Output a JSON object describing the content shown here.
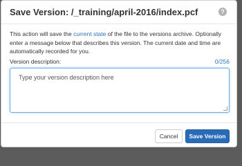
{
  "dialog": {
    "title": "Save Version: /_training/april-2016/index.pcf",
    "help_icon": "question-circle-icon",
    "description_part1": "This action will save the ",
    "description_link": "current state",
    "description_part2": " of the file to the versions archive. Optionally enter a message below that describes this version. The current date and time are automatically recorded for you.",
    "field_label": "Version description:",
    "char_count": "0/256",
    "textarea_placeholder": "Type your version description here",
    "cancel_label": "Cancel",
    "save_label": "Save Version"
  },
  "colors": {
    "link": "#2d72b8",
    "primary_button": "#2a6bb8",
    "focus_border": "#66afe9",
    "backdrop": "#5a5a5a"
  }
}
